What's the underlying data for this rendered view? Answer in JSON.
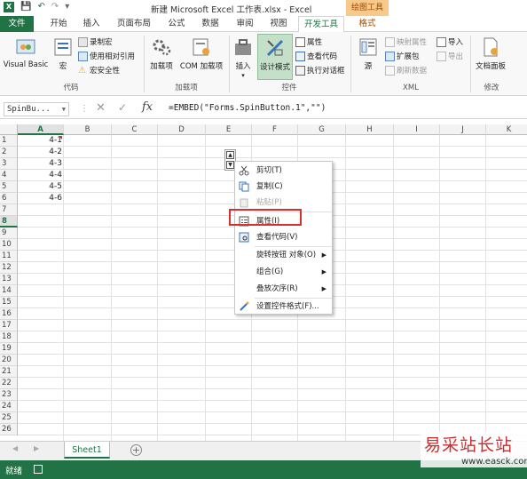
{
  "app": {
    "title": "新建 Microsoft Excel 工作表.xlsx - Excel",
    "contextual_tab_group": "绘图工具"
  },
  "tabs": [
    "文件",
    "开始",
    "插入",
    "页面布局",
    "公式",
    "数据",
    "审阅",
    "视图",
    "开发工具",
    "格式"
  ],
  "ribbon": {
    "code_group": {
      "label": "代码",
      "visual_basic": "Visual Basic",
      "macros": "宏",
      "record_macro": "录制宏",
      "relative_ref": "使用相对引用",
      "macro_security": "宏安全性"
    },
    "addins_group": {
      "label": "加载项",
      "addins": "加载项",
      "com_addins": "COM 加载项"
    },
    "controls_group": {
      "label": "控件",
      "insert": "插入",
      "design_mode": "设计模式",
      "properties": "属性",
      "view_code": "查看代码",
      "run_dialog": "执行对话框"
    },
    "xml_group": {
      "label": "XML",
      "source": "源",
      "map_properties": "映射属性",
      "expansion_packs": "扩展包",
      "refresh_data": "刷新数据",
      "import": "导入",
      "export": "导出"
    },
    "modify_group": {
      "label": "修改",
      "document_panel": "文档面板"
    }
  },
  "formula_bar": {
    "name_box": "SpinBu...",
    "fx": "fx",
    "formula": "=EMBED(\"Forms.SpinButton.1\",\"\")"
  },
  "grid": {
    "columns": [
      "A",
      "B",
      "C",
      "D",
      "E",
      "F",
      "G",
      "H",
      "I",
      "J",
      "K"
    ],
    "rows": [
      "1",
      "2",
      "3",
      "4",
      "5",
      "6",
      "7",
      "8",
      "9",
      "10",
      "11",
      "12",
      "13",
      "14",
      "15",
      "16",
      "17",
      "18",
      "19",
      "20",
      "21",
      "22",
      "23",
      "24",
      "25",
      "26"
    ],
    "cells_A": [
      "4-1",
      "4-2",
      "4-3",
      "4-4",
      "4-5",
      "4-6"
    ],
    "selected_column": "A",
    "selected_row": "8"
  },
  "context_menu": {
    "items": [
      {
        "label": "剪切(T)",
        "icon": "scissors-icon",
        "enabled": true
      },
      {
        "label": "复制(C)",
        "icon": "copy-icon",
        "enabled": true
      },
      {
        "label": "粘贴(P)",
        "icon": "paste-icon",
        "enabled": false
      },
      {
        "label": "属性(I)",
        "icon": "properties-icon",
        "enabled": true,
        "highlighted": true
      },
      {
        "label": "查看代码(V)",
        "icon": "view-code-icon",
        "enabled": true
      },
      {
        "label": "旋转按钮 对象(O)",
        "icon": "",
        "enabled": true,
        "submenu": true
      },
      {
        "label": "组合(G)",
        "icon": "",
        "enabled": true,
        "submenu": true
      },
      {
        "label": "叠放次序(R)",
        "icon": "",
        "enabled": true,
        "submenu": true
      },
      {
        "label": "设置控件格式(F)...",
        "icon": "format-control-icon",
        "enabled": true
      }
    ]
  },
  "sheets": [
    "Sheet1"
  ],
  "status": "就绪",
  "watermark": {
    "title": "易采站长站",
    "url": "www.easck.com"
  },
  "colors": {
    "excel_green": "#217346",
    "highlight_red": "#d9302f",
    "contextual_orange": "#f7c98b"
  }
}
